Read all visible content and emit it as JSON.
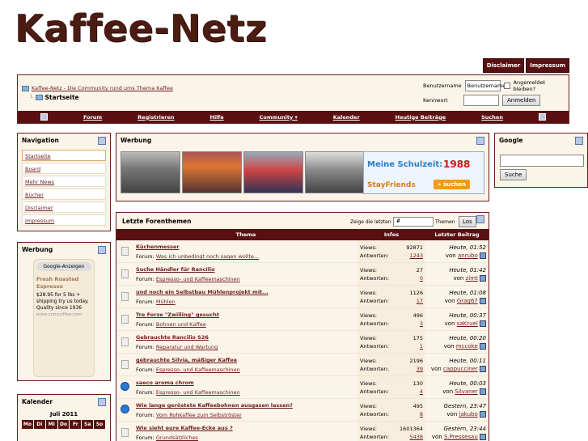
{
  "logo": "Kaffee-Netz",
  "top_tabs": [
    "Disclaimer",
    "Impressum"
  ],
  "breadcrumb": {
    "home": "Kaffee-Netz - Die Community rund ums Thema Kaffee",
    "current": "Startseite"
  },
  "login": {
    "user_label": "Benutzername",
    "user_value": "Benutzername",
    "remember": "Angemeldet bleiben?",
    "pass_label": "Kennwort",
    "submit": "Anmelden"
  },
  "menu": [
    "Forum",
    "Registrieren",
    "Hilfe",
    "Community ▾",
    "Kalender",
    "Heutige Beiträge",
    "Suchen"
  ],
  "nav": {
    "title": "Navigation",
    "items": [
      "Startseite",
      "Board",
      "Mehr News",
      "Bücher",
      "Disclaimer",
      "Impressum"
    ]
  },
  "ad_panel": {
    "title": "Werbung",
    "google": "Google-Anzeigen",
    "ad_title": "Fresh Roasted Espresso",
    "ad_text": "$28.95 for 5 lbs + shipping try us today. Quality since 1936",
    "ad_url": "www.ccmcoffee.com"
  },
  "calendar": {
    "title": "Kalender",
    "month": "Juli 2011",
    "days": [
      "Mo",
      "Di",
      "Mi",
      "Do",
      "Fr",
      "Sa",
      "So"
    ]
  },
  "werbung": {
    "title": "Werbung",
    "school_title": "Meine Schulzeit:",
    "school_year": "1988",
    "brand": "StayFriends",
    "search_btn": "» suchen"
  },
  "google": {
    "title": "Google",
    "button": "Suche"
  },
  "forum": {
    "title": "Letzte Forenthemen",
    "show_label": "Zeige die letzten",
    "show_value": "#",
    "themen": "Themen",
    "go": "Los",
    "cols": [
      "Thema",
      "Infos",
      "Letzter Beitrag"
    ],
    "views_label": "Views:",
    "answers_label": "Antworten:",
    "forum_label": "Forum:",
    "by_label": "von",
    "rows": [
      {
        "title": "Küchenmesser",
        "forum": "Was ich unbedingt noch sagen wollte...",
        "views": "92871",
        "answers": "1243",
        "date": "Heute, 01:52",
        "user": "anrubo",
        "icon": "doc"
      },
      {
        "title": "Suche Händler für Rancilio",
        "forum": "Espresso- und Kaffeemaschinen",
        "views": "27",
        "answers": "0",
        "date": "Heute, 01:42",
        "user": "zimt",
        "icon": "doc"
      },
      {
        "title": "und noch ein Selbstbau Mühlenprojekt mit...",
        "forum": "Mühlen",
        "views": "1126",
        "answers": "17",
        "date": "Heute, 01:08",
        "user": "Grag67",
        "icon": "doc"
      },
      {
        "title": "Tre Forze \"Zwilling\" gesucht",
        "forum": "Bohnen und Kaffee",
        "views": "496",
        "answers": "3",
        "date": "Heute, 00:37",
        "user": "saKruel",
        "icon": "doc"
      },
      {
        "title": "Gebrauchte Rancilio S26",
        "forum": "Reparatur und Wartung",
        "views": "175",
        "answers": "1",
        "date": "Heute, 00:20",
        "user": "mccoke",
        "icon": "doc"
      },
      {
        "title": "gebrauchte Silvia, mäßiger Kaffee",
        "forum": "Espresso- und Kaffeemaschinen",
        "views": "2196",
        "answers": "39",
        "date": "Heute, 00:11",
        "user": "cappucciner",
        "icon": "doc"
      },
      {
        "title": "saeco aroma chrom",
        "forum": "Espresso- und Kaffeemaschinen",
        "views": "130",
        "answers": "4",
        "date": "Heute, 00:03",
        "user": "Silvaner",
        "icon": "q"
      },
      {
        "title": "Wie lange geröstete Kaffeebohnen ausgasen lassen?",
        "forum": "Vom Rohkaffee zum Selbströster",
        "views": "495",
        "answers": "8",
        "date": "Gestern, 23:47",
        "user": "jakubo",
        "icon": "q"
      },
      {
        "title": "Wie sieht eure Kaffee-Ecke aus ?",
        "forum": "Grundsätzliches",
        "views": "1601364",
        "answers": "5438",
        "date": "Gestern, 23:44",
        "user": "S.Pressesau",
        "icon": "doc"
      }
    ]
  }
}
